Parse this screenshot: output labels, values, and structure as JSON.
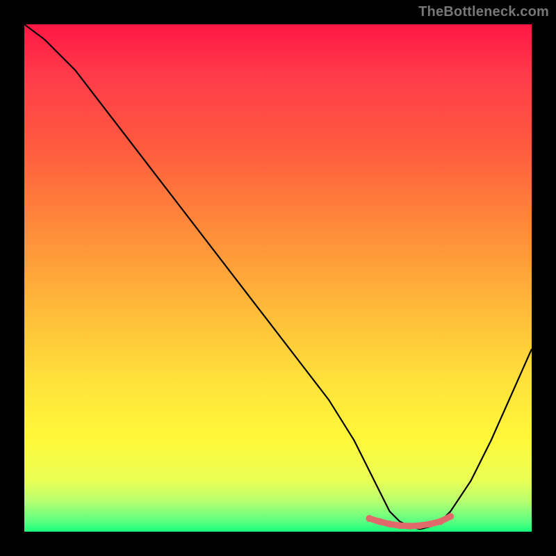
{
  "watermark": "TheBottleneck.com",
  "colors": {
    "background": "#000000",
    "gradient_top": "#ff1744",
    "gradient_bottom": "#19ff7a",
    "curve": "#000000",
    "highlight": "#e06a6a"
  },
  "chart_data": {
    "type": "line",
    "title": "",
    "xlabel": "",
    "ylabel": "",
    "xlim": [
      0,
      100
    ],
    "ylim": [
      0,
      100
    ],
    "series": [
      {
        "name": "bottleneck-curve",
        "x": [
          0,
          4,
          10,
          20,
          30,
          40,
          50,
          60,
          65,
          68,
          70,
          72,
          74,
          76,
          78,
          80,
          82,
          84,
          88,
          92,
          96,
          100
        ],
        "y": [
          100,
          97,
          91,
          78,
          65,
          52,
          39,
          26,
          18,
          12,
          8,
          4,
          2,
          1,
          0.5,
          1,
          2,
          4,
          10,
          18,
          27,
          36
        ]
      }
    ],
    "highlight_segment": {
      "name": "optimal-region",
      "x": [
        68,
        70,
        72,
        74,
        76,
        78,
        80,
        82,
        84
      ],
      "y": [
        2.6,
        2.0,
        1.5,
        1.2,
        1.1,
        1.2,
        1.5,
        2.0,
        3.0
      ]
    }
  }
}
